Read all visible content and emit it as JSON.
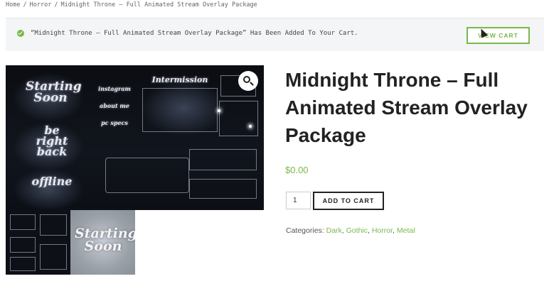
{
  "breadcrumb": {
    "items": [
      "Home",
      "Horror",
      "Midnight Throne – Full Animated Stream Overlay Package"
    ],
    "separator": "/"
  },
  "notice": {
    "message": "“Midnight Throne – Full Animated Stream Overlay Package” Has Been Added To Your Cart.",
    "button_label": "VIEW CART"
  },
  "gallery": {
    "main_texts": {
      "starting": "Starting\nSoon",
      "beright": "be right\nback",
      "offline": "offline",
      "intermission": "Intermission",
      "instagram": "instagram",
      "about": "about me",
      "pc": "pc specs"
    },
    "thumb2_text": "Starting\nSoon"
  },
  "product": {
    "title": "Midnight Throne – Full Animated Stream Overlay Package",
    "price": "$0.00",
    "quantity": "1",
    "add_to_cart_label": "ADD TO CART",
    "categories_label": "Categories:",
    "categories": [
      "Dark",
      "Gothic",
      "Horror",
      "Metal"
    ]
  },
  "colors": {
    "accent": "#7bb84a",
    "notice_bg": "#f4f5f6"
  }
}
